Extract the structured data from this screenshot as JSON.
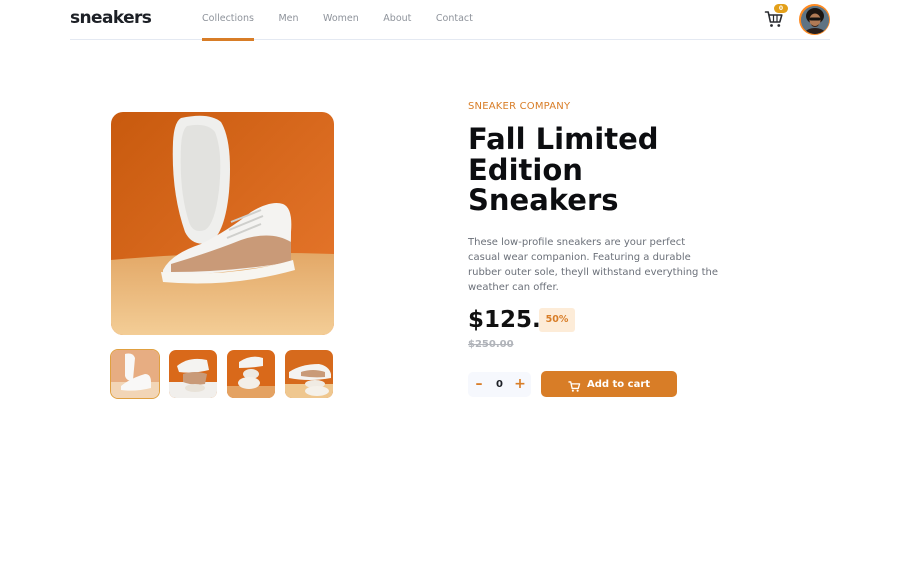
{
  "header": {
    "logo": "sneakers",
    "nav": [
      {
        "label": "Collections",
        "active": true
      },
      {
        "label": "Men",
        "active": false
      },
      {
        "label": "Women",
        "active": false
      },
      {
        "label": "About",
        "active": false
      },
      {
        "label": "Contact",
        "active": false
      }
    ],
    "cart": {
      "icon": "cart-icon",
      "badge_count": "0"
    },
    "avatar": {
      "icon": "user-avatar"
    }
  },
  "gallery": {
    "main_image": "white sneaker on orange background",
    "thumbnails": [
      {
        "index": 1,
        "active": true
      },
      {
        "index": 2,
        "active": false
      },
      {
        "index": 3,
        "active": false
      },
      {
        "index": 4,
        "active": false
      }
    ]
  },
  "product": {
    "company": "SNEAKER COMPANY",
    "title": "Fall Limited Edition Sneakers",
    "description": "These low-profile sneakers are your perfect casual wear companion. Featuring a durable rubber outer sole, theyll withstand everything the weather can offer.",
    "price": "$125.",
    "discount": "50%",
    "old_price": "$250.00"
  },
  "cart_controls": {
    "minus_label": "–",
    "quantity": "0",
    "plus_label": "+",
    "add_label": "Add to cart",
    "add_icon": "cart-icon"
  },
  "colors": {
    "accent": "#d87d27",
    "accent_light": "#fdecd8",
    "text_dark": "#1d2026",
    "text_muted": "#6b7079"
  }
}
